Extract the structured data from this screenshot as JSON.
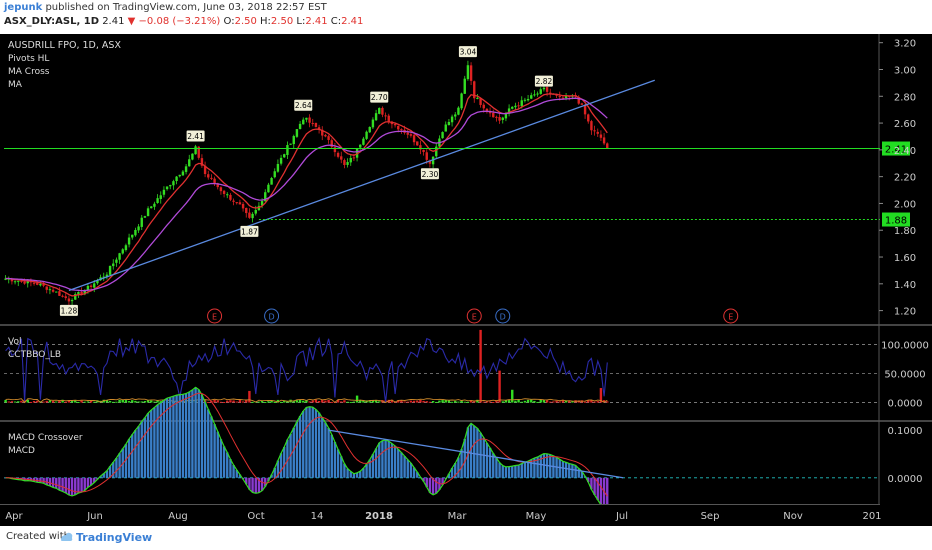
{
  "header": {
    "user": "jepunk",
    "published": "published on TradingView.com, June 03, 2018 22:57 EST",
    "symbol": "ASX_DLY:ASL, 1D",
    "last": "2.41",
    "change": "−0.08 (−3.21%)",
    "o_label": "O:",
    "o": "2.50",
    "h_label": "H:",
    "h": "2.50",
    "l_label": "L:",
    "l": "2.41",
    "c_label": "C:",
    "c": "2.41"
  },
  "footer": {
    "created": "Created with",
    "brand": "TradingView"
  },
  "colors": {
    "bg": "#000000",
    "up": "#33dd22",
    "down": "#dd2222",
    "ma_fast": "#e03030",
    "ma_slow": "#b04ad8",
    "trend": "#5a8ae0",
    "level": "#22dd22",
    "vol_line": "#2a2aa8"
  },
  "chart_data": [
    {
      "type": "candlestick",
      "legend": [
        "AUSDRILL FPO, 1D, ASX",
        "Pivots HL",
        "MA Cross",
        "MA"
      ],
      "x_ticks": [
        "Apr",
        "Jun",
        "Aug",
        "Oct",
        "14",
        "2018",
        "Mar",
        "May",
        "Jul",
        "Sep",
        "Nov",
        "201"
      ],
      "y_ticks": [
        "3.20",
        "3.00",
        "2.80",
        "2.60",
        "2.40",
        "2.20",
        "2.00",
        "1.80",
        "1.60",
        "1.40",
        "1.20"
      ],
      "ylim": [
        1.1,
        3.25
      ],
      "path": [
        [
          0,
          1.44
        ],
        [
          10,
          1.4
        ],
        [
          15,
          1.35
        ],
        [
          20,
          1.28
        ],
        [
          25,
          1.35
        ],
        [
          32,
          1.48
        ],
        [
          38,
          1.7
        ],
        [
          45,
          1.95
        ],
        [
          52,
          2.15
        ],
        [
          57,
          2.28
        ],
        [
          60,
          2.41
        ],
        [
          63,
          2.22
        ],
        [
          68,
          2.1
        ],
        [
          74,
          1.98
        ],
        [
          77,
          1.88
        ],
        [
          80,
          1.98
        ],
        [
          84,
          2.2
        ],
        [
          89,
          2.42
        ],
        [
          94,
          2.64
        ],
        [
          99,
          2.55
        ],
        [
          104,
          2.4
        ],
        [
          107,
          2.28
        ],
        [
          110,
          2.35
        ],
        [
          114,
          2.55
        ],
        [
          118,
          2.7
        ],
        [
          122,
          2.6
        ],
        [
          127,
          2.52
        ],
        [
          131,
          2.42
        ],
        [
          134,
          2.3
        ],
        [
          138,
          2.55
        ],
        [
          143,
          2.7
        ],
        [
          146,
          3.04
        ],
        [
          148,
          2.8
        ],
        [
          152,
          2.7
        ],
        [
          156,
          2.62
        ],
        [
          160,
          2.72
        ],
        [
          165,
          2.78
        ],
        [
          170,
          2.85
        ],
        [
          175,
          2.78
        ],
        [
          180,
          2.8
        ],
        [
          182,
          2.72
        ],
        [
          185,
          2.55
        ],
        [
          188,
          2.49
        ],
        [
          190,
          2.41
        ]
      ],
      "pivots": [
        {
          "i": 20,
          "label": "1.28",
          "kind": "low"
        },
        {
          "i": 60,
          "label": "2.41",
          "kind": "high"
        },
        {
          "i": 77,
          "label": "1.87",
          "kind": "low"
        },
        {
          "i": 94,
          "label": "2.64",
          "kind": "high"
        },
        {
          "i": 118,
          "label": "2.70",
          "kind": "high"
        },
        {
          "i": 134,
          "label": "2.30",
          "kind": "low"
        },
        {
          "i": 146,
          "label": "3.04",
          "kind": "high"
        },
        {
          "i": 170,
          "label": "2.82",
          "kind": "high"
        }
      ],
      "trendline": {
        "from": [
          20,
          1.35
        ],
        "to": [
          205,
          2.92
        ]
      },
      "levels": [
        {
          "value": 2.41,
          "label": "2.41",
          "style": "solid",
          "start": 0
        },
        {
          "value": 1.88,
          "label": "1.88",
          "style": "dotted",
          "start": 80
        }
      ],
      "events": [
        {
          "i": 66,
          "label": "E",
          "kind": "earnings"
        },
        {
          "i": 84,
          "label": "D",
          "kind": "dividend"
        },
        {
          "i": 148,
          "label": "E",
          "kind": "earnings"
        },
        {
          "i": 157,
          "label": "D",
          "kind": "dividend"
        },
        {
          "i": 229,
          "label": "E",
          "kind": "earnings"
        }
      ]
    },
    {
      "type": "line",
      "legend": [
        "Vol",
        "CCTBBO_LB"
      ],
      "y_ticks": [
        "100.0000",
        "50.0000",
        "0.0000"
      ],
      "ylim": [
        -30,
        130
      ],
      "vol_spikes": [
        {
          "i": 77,
          "value": 20
        },
        {
          "i": 111,
          "value": 12
        },
        {
          "i": 150,
          "value": 125
        },
        {
          "i": 156,
          "value": 55
        },
        {
          "i": 160,
          "value": 22
        },
        {
          "i": 188,
          "value": 25
        }
      ]
    },
    {
      "type": "bar",
      "legend": [
        "MACD Crossover",
        "MACD"
      ],
      "y_ticks": [
        "0.1000",
        "0.0000"
      ],
      "ylim": [
        -0.055,
        0.115
      ],
      "downtrend": {
        "from": [
          102,
          0.1
        ],
        "to": [
          195,
          0.0
        ]
      }
    }
  ]
}
